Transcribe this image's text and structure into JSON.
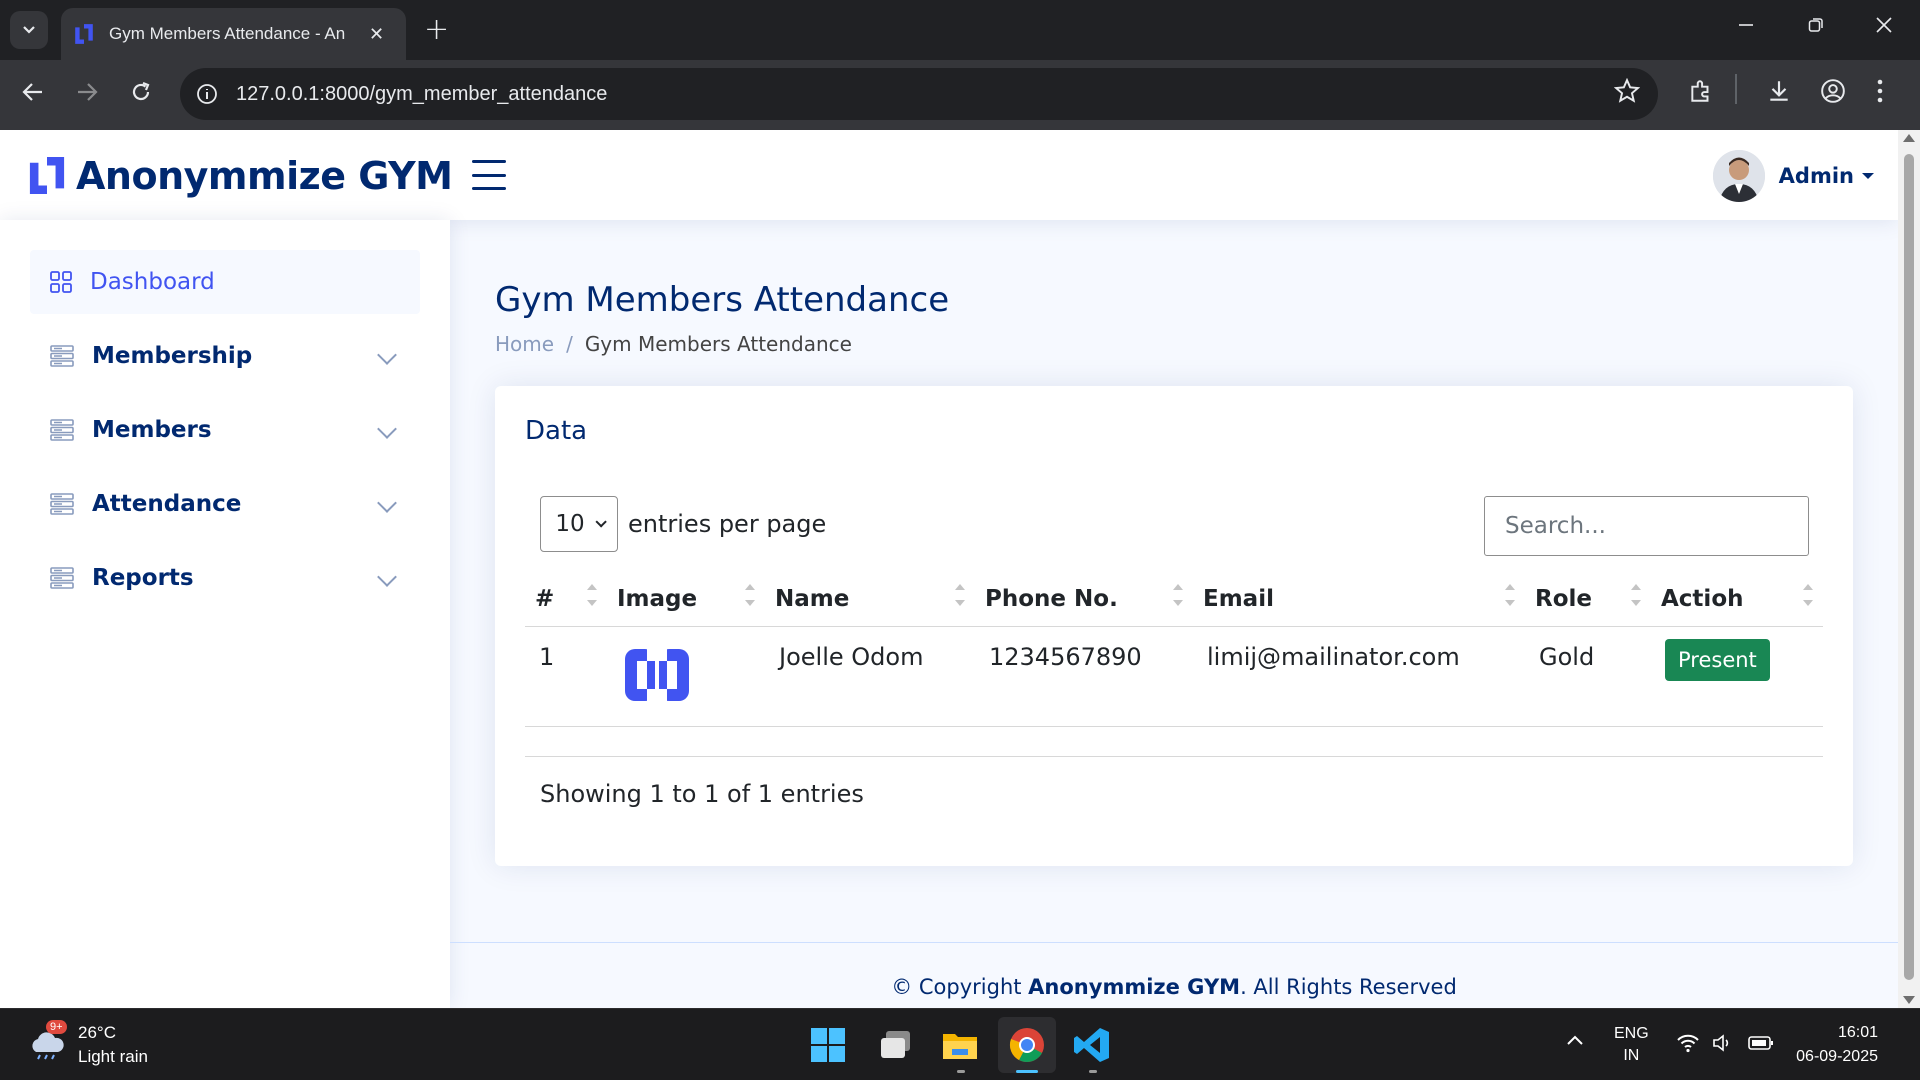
{
  "browser": {
    "tab_title": "Gym Members Attendance - An",
    "url_host": "127.0.0.1",
    "url_path": ":8000/gym_member_attendance"
  },
  "header": {
    "brand": "Anonymmize GYM",
    "user_name": "Admin"
  },
  "sidebar": {
    "items": [
      {
        "label": "Dashboard"
      },
      {
        "label": "Membership"
      },
      {
        "label": "Members"
      },
      {
        "label": "Attendance"
      },
      {
        "label": "Reports"
      }
    ]
  },
  "page": {
    "title": "Gym Members Attendance",
    "breadcrumb_home": "Home",
    "breadcrumb_sep": "/",
    "breadcrumb_current": "Gym Members Attendance"
  },
  "card": {
    "title": "Data",
    "per_page_value": "10",
    "per_page_label": "entries per page",
    "search_placeholder": "Search...",
    "columns": [
      "#",
      "Image",
      "Name",
      "Phone No.",
      "Email",
      "Role",
      "Actioh"
    ],
    "rows": [
      {
        "num": "1",
        "name": "Joelle Odom",
        "phone": "1234567890",
        "email": "limij@mailinator.com",
        "role": "Gold",
        "action": "Present"
      }
    ],
    "info": "Showing 1 to 1 of 1 entries"
  },
  "footer": {
    "prefix": "© Copyright ",
    "brand": "Anonymmize GYM",
    "suffix": ". All Rights Reserved"
  },
  "taskbar": {
    "weather_temp": "26°C",
    "weather_desc": "Light rain",
    "weather_badge": "9+",
    "lang_1": "ENG",
    "lang_2": "IN",
    "time": "16:01",
    "date": "06-09-2025"
  },
  "colors": {
    "primary": "#4154f1",
    "navy": "#012970",
    "success": "#198754"
  }
}
